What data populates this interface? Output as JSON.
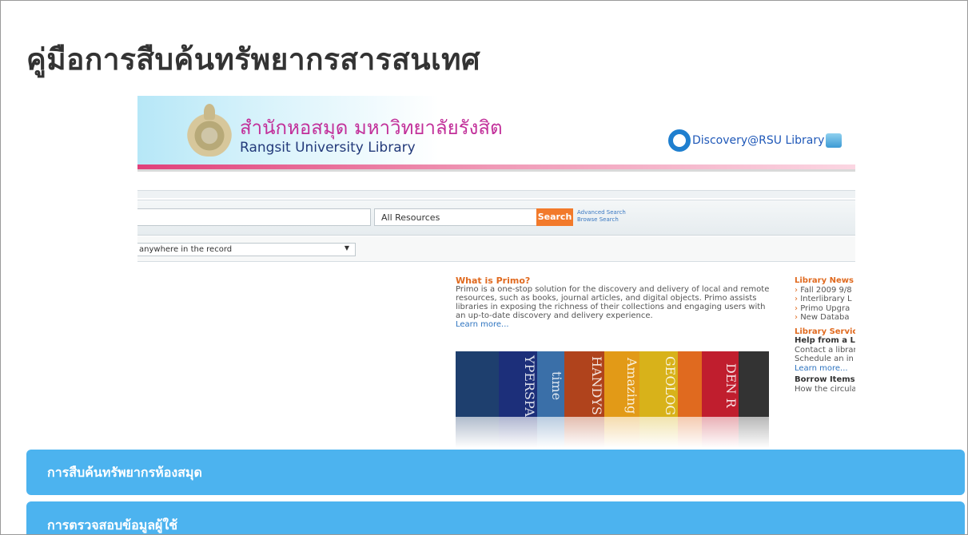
{
  "page": {
    "title": "คู่มือการสืบค้นทรัพยากรสารสนเทศ"
  },
  "library": {
    "name_th": "สำนักหอสมุด มหาวิทยาลัยรังสิต",
    "name_en": "Rangsit University Library",
    "discovery": "Discovery@RSU Library"
  },
  "search": {
    "scope_value": "All Resources",
    "button_label": "Search",
    "advanced_link": "Advanced Search",
    "browse_link": "Browse Search",
    "field_value": "anywhere in the record"
  },
  "primo": {
    "heading": "What is Primo?",
    "body": "Primo is a one-stop solution for the discovery and delivery of local and remote resources, such as books, journal articles, and digital objects. Primo assists libraries in exposing the richness of their collections and engaging users with an up-to-date discovery and delivery experience.",
    "learn_more": "Learn more..."
  },
  "books": [
    {
      "title": "",
      "color": "#1e3f6e"
    },
    {
      "title": "YPERSPA",
      "color": "#1c2f7a"
    },
    {
      "title": "time",
      "color": "#3a6fa8"
    },
    {
      "title": "HANDYS",
      "color": "#b0431c"
    },
    {
      "title": "Amazing",
      "color": "#e29a17"
    },
    {
      "title": "GEOLOG",
      "color": "#d8b21a"
    },
    {
      "title": "",
      "color": "#e06a1f"
    },
    {
      "title": "DEN R",
      "color": "#c01e2e"
    },
    {
      "title": "",
      "color": "#333333"
    }
  ],
  "news": {
    "heading": "Library News",
    "items": [
      "Fall 2009 9/8",
      "Interlibrary L",
      "Primo Upgra",
      "New Databa"
    ],
    "services_heading": "Library Servic",
    "help_heading": "Help from a Li",
    "help_lines": [
      "Contact a librar",
      "Schedule an in"
    ],
    "learn_more": "Learn more...",
    "borrow_heading": "Borrow Items",
    "borrow_line": "How the circula"
  },
  "accordion": [
    {
      "label": "การสืบค้นทรัพยากรห้องสมุด"
    },
    {
      "label": "การตรวจสอบข้อมูลผู้ใช้"
    }
  ],
  "colors": {
    "accent": "#4cb3ef",
    "search_button": "#f27a2b",
    "link": "#2e74c0"
  }
}
